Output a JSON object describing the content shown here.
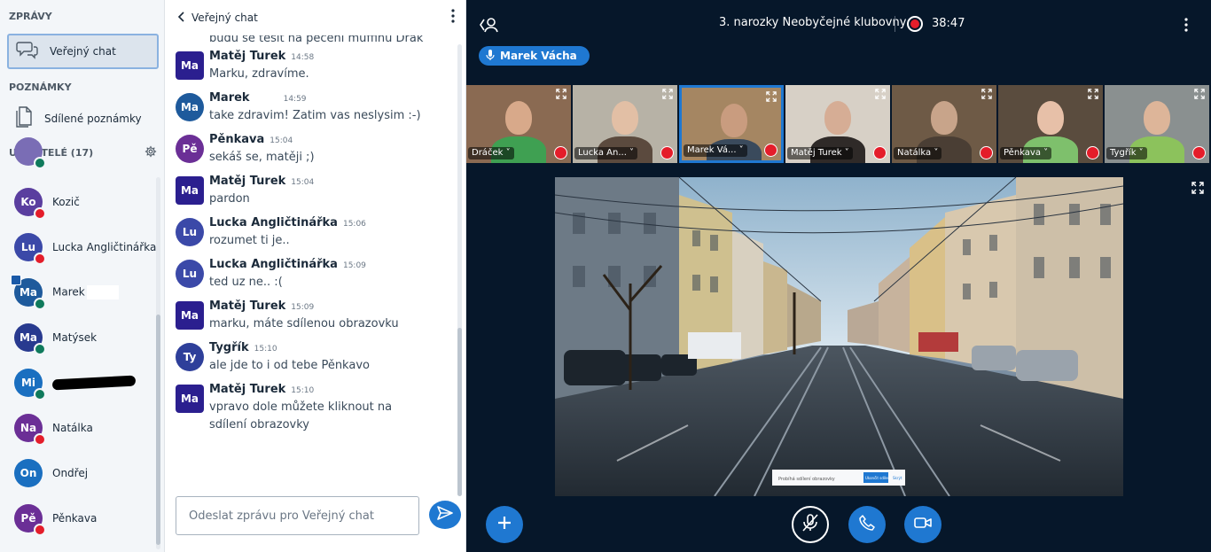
{
  "sidebar": {
    "messages_title": "ZPRÁVY",
    "public_chat_label": "Veřejný chat",
    "notes_title": "POZNÁMKY",
    "shared_notes_label": "Sdílené poznámky",
    "users_title": "UŽIVATELÉ (17)",
    "users": [
      {
        "initials": "",
        "name": "",
        "color": "#7a6db5",
        "status": "listen"
      },
      {
        "initials": "Ko",
        "name": "Kozič",
        "color": "#5a3e9f",
        "status": "muted"
      },
      {
        "initials": "Lu",
        "name": "Lucka Angličtinářka",
        "color": "#3b49a8",
        "status": "muted"
      },
      {
        "initials": "Ma",
        "name": "Marek",
        "color": "#1e5a9c",
        "status": "listen",
        "presenter": true
      },
      {
        "initials": "Ma",
        "name": "Matýsek",
        "color": "#283a8f",
        "status": "listen"
      },
      {
        "initials": "Mi",
        "name": "",
        "color": "#1a6fc0",
        "status": "listen"
      },
      {
        "initials": "Na",
        "name": "Natálka",
        "color": "#6b2f96",
        "status": "muted"
      },
      {
        "initials": "On",
        "name": "Ondřej",
        "color": "#1a6fc0",
        "status": "none"
      },
      {
        "initials": "Pě",
        "name": "Pěnkava",
        "color": "#6b2f96",
        "status": "muted"
      }
    ]
  },
  "chat": {
    "title": "Veřejný chat",
    "partial_top": "budu se těšit na pečení muffinu Drak",
    "messages": [
      {
        "initials": "Ma",
        "author": "Matěj Turek",
        "time": "14:58",
        "text": "Marku, zdravíme.",
        "color": "#2b1f8f",
        "round": false
      },
      {
        "initials": "Ma",
        "author": "Marek",
        "time": "14:59",
        "text": "take zdravim! Zatim vas neslysim :-)",
        "color": "#1e5a9c",
        "round": true
      },
      {
        "initials": "Pě",
        "author": "Pěnkava",
        "time": "15:04",
        "text": "sekáš se, matěji ;)",
        "color": "#6b2f96",
        "round": true
      },
      {
        "initials": "Ma",
        "author": "Matěj Turek",
        "time": "15:04",
        "text": "pardon",
        "color": "#2b1f8f",
        "round": false
      },
      {
        "initials": "Lu",
        "author": "Lucka Angličtinářka",
        "time": "15:06",
        "text": "rozumet ti je..",
        "color": "#3b49a8",
        "round": true
      },
      {
        "initials": "Lu",
        "author": "Lucka Angličtinářka",
        "time": "15:09",
        "text": "ted uz ne.. :(",
        "color": "#3b49a8",
        "round": true
      },
      {
        "initials": "Ma",
        "author": "Matěj Turek",
        "time": "15:09",
        "text": "marku, máte sdílenou obrazovku",
        "color": "#2b1f8f",
        "round": false
      },
      {
        "initials": "Ty",
        "author": "Tygřík",
        "time": "15:10",
        "text": "ale jde to i od tebe Pěnkavo",
        "color": "#2e3f9a",
        "round": true
      },
      {
        "initials": "Ma",
        "author": "Matěj Turek",
        "time": "15:10",
        "text": "vpravo dole můžete kliknout na sdílení obrazovky",
        "color": "#2b1f8f",
        "round": false
      }
    ],
    "input_placeholder": "Odeslat zprávu pro Veřejný chat"
  },
  "meeting": {
    "title": "3. narozky Neobyčejné klubovny",
    "timer": "38:47",
    "talking": "Marek Vácha",
    "tiles": [
      {
        "name": "Dráček",
        "bg": "#8a6a52",
        "face": "#d8a98a",
        "shirt": "#3fa052",
        "active": false
      },
      {
        "name": "Lucka An...",
        "bg": "#b7b2a6",
        "face": "#e2bfa5",
        "shirt": "#5b4a3e",
        "active": false
      },
      {
        "name": "Marek Vá...",
        "bg": "#a58662",
        "face": "#c99c7f",
        "shirt": "#3a4a5c",
        "active": true
      },
      {
        "name": "Matěj Turek",
        "bg": "#d7d0c6",
        "face": "#d6ad95",
        "shirt": "#2f2a28",
        "active": false
      },
      {
        "name": "Natálka",
        "bg": "#6e5a46",
        "face": "#c8a48a",
        "shirt": "#4a3e34",
        "active": false
      },
      {
        "name": "Pěnkava",
        "bg": "#5a4c3e",
        "face": "#e7c0a8",
        "shirt": "#7ec06c",
        "active": false
      },
      {
        "name": "Tygřík",
        "bg": "#8a9090",
        "face": "#ddb599",
        "shirt": "#8cc25c",
        "active": false
      }
    ],
    "share_bar_text": "Probíhá sdílení obrazovky",
    "share_bar_stop": "Ukončit sdílení",
    "share_bar_hide": "Skrýt",
    "colors": {
      "accent": "#1f78d1",
      "background": "#06172a",
      "recording": "#e41d2a"
    }
  }
}
